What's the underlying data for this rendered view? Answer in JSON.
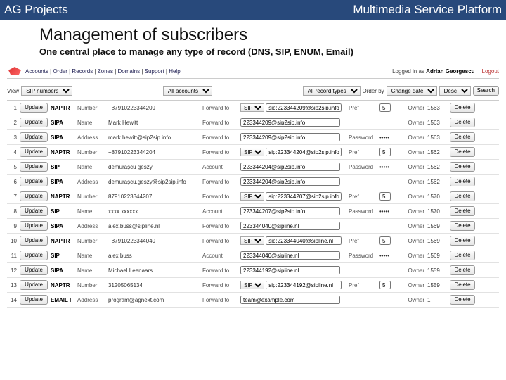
{
  "topbar": {
    "left": "AG Projects",
    "right": "Multimedia Service Platform"
  },
  "heading": {
    "title": "Management of subscribers",
    "subtitle": "One central place to manage any type of record (DNS, SIP, ENUM, Email)"
  },
  "nav": {
    "links": [
      "Accounts",
      "Order",
      "Records",
      "Zones",
      "Domains",
      "Support",
      "Help"
    ],
    "logged_prefix": "Logged in as",
    "user": "Adrian Georgescu",
    "logout": "Logout"
  },
  "filters": {
    "view_label": "View",
    "type_select": "SIP numbers",
    "account_select": "All accounts",
    "record_type_select": "All record types",
    "order_by_label": "Order by",
    "order_by_select": "Change date",
    "dir_select": "Desc",
    "search": "Search"
  },
  "buttons": {
    "update": "Update",
    "delete": "Delete"
  },
  "owner_label": "Owner",
  "rows": [
    {
      "n": "1",
      "type": "NAPTR",
      "klabel": "Number",
      "kval": "+87910223344209",
      "f1label": "Forward to",
      "f1sel": "SIP",
      "f2": "sip:223344209@sip2sip.info",
      "f3label": "Pref",
      "f3val": "5",
      "owner": "1563"
    },
    {
      "n": "2",
      "type": "SIPA",
      "klabel": "Name",
      "kval": "Mark Hewitt",
      "f1label": "Forward to",
      "f1sel": "",
      "f2": "223344209@sip2sip.info",
      "f3label": "",
      "f3val": "",
      "owner": "1563"
    },
    {
      "n": "3",
      "type": "SIPA",
      "klabel": "Address",
      "kval": "mark.hewitt@sip2sip.info",
      "f1label": "Forward to",
      "f1sel": "",
      "f2": "223344209@sip2sip.info",
      "f3label": "Password",
      "f3val": "•••••",
      "owner": "1563"
    },
    {
      "n": "4",
      "type": "NAPTR",
      "klabel": "Number",
      "kval": "+87910223344204",
      "f1label": "Forward to",
      "f1sel": "SIP",
      "f2": "sip:223344204@sip2sip.info",
      "f3label": "Pref",
      "f3val": "5",
      "owner": "1562"
    },
    {
      "n": "5",
      "type": "SIP",
      "klabel": "Name",
      "kval": "demuraşcu geszy",
      "f1label": "Account",
      "f1sel": "",
      "f2": "223344204@sip2sip.info",
      "f3label": "Password",
      "f3val": "•••••",
      "owner": "1562"
    },
    {
      "n": "6",
      "type": "SIPA",
      "klabel": "Address",
      "kval": "demuraşcu.geszy@sip2sip.info",
      "f1label": "Forward to",
      "f1sel": "",
      "f2": "223344204@sip2sip.info",
      "f3label": "",
      "f3val": "",
      "owner": "1562"
    },
    {
      "n": "7",
      "type": "NAPTR",
      "klabel": "Number",
      "kval": "87910223344207",
      "f1label": "Forward to",
      "f1sel": "SIP",
      "f2": "sip:223344207@sip2sip.info",
      "f3label": "Pref",
      "f3val": "5",
      "owner": "1570"
    },
    {
      "n": "8",
      "type": "SIP",
      "klabel": "Name",
      "kval": "xxxx xxxxxx",
      "f1label": "Account",
      "f1sel": "",
      "f2": "223344207@sip2sip.info",
      "f3label": "Password",
      "f3val": "•••••",
      "owner": "1570"
    },
    {
      "n": "9",
      "type": "SIPA",
      "klabel": "Address",
      "kval": "alex.buss@sipline.nl",
      "f1label": "Forward to",
      "f1sel": "",
      "f2": "223344040@sipline.nl",
      "f3label": "",
      "f3val": "",
      "owner": "1569"
    },
    {
      "n": "10",
      "type": "NAPTR",
      "klabel": "Number",
      "kval": "+87910223344040",
      "f1label": "Forward to",
      "f1sel": "SIP",
      "f2": "sip:223344040@sipline.nl",
      "f3label": "Pref",
      "f3val": "5",
      "owner": "1569"
    },
    {
      "n": "11",
      "type": "SIP",
      "klabel": "Name",
      "kval": "alex buss",
      "f1label": "Account",
      "f1sel": "",
      "f2": "223344040@sipline.nl",
      "f3label": "Password",
      "f3val": "•••••",
      "owner": "1569"
    },
    {
      "n": "12",
      "type": "SIPA",
      "klabel": "Name",
      "kval": "Michael Leenaars",
      "f1label": "Forward to",
      "f1sel": "",
      "f2": "223344192@sipline.nl",
      "f3label": "",
      "f3val": "",
      "owner": "1559"
    },
    {
      "n": "13",
      "type": "NAPTR",
      "klabel": "Number",
      "kval": "31205065134",
      "f1label": "Forward to",
      "f1sel": "SIP",
      "f2": "sip:223344192@sipline.nl",
      "f3label": "Pref",
      "f3val": "5",
      "owner": "1559"
    },
    {
      "n": "14",
      "type": "EMAIL F",
      "klabel": "Address",
      "kval": "program@agnext.com",
      "f1label": "Forward to",
      "f1sel": "",
      "f2": "team@example.com",
      "f3label": "",
      "f3val": "",
      "owner": "1"
    }
  ]
}
